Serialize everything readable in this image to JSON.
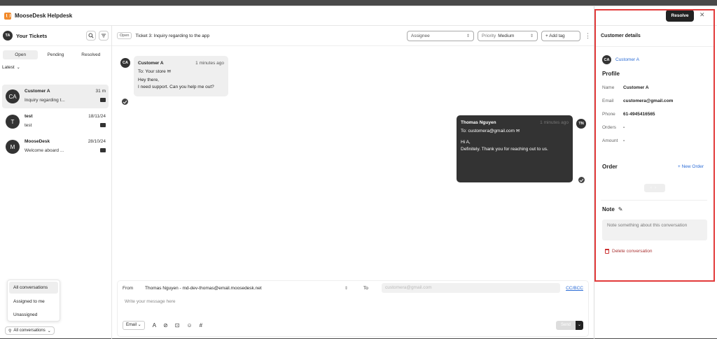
{
  "app": {
    "title": "MooseDesk Helpdesk"
  },
  "sidebar": {
    "avatar": "TA",
    "title": "Your Tickets",
    "tabs": [
      "Open",
      "Pending",
      "Resolved"
    ],
    "sort_label": "Latest",
    "conversations": [
      {
        "avatar": "CA",
        "name": "Customer A",
        "preview": "Inquiry regarding t...",
        "time": "31 m"
      },
      {
        "avatar": "T",
        "name": "test",
        "preview": "test",
        "time": "18/11/24"
      },
      {
        "avatar": "M",
        "name": "MooseDesk",
        "preview": "Welcome aboard ...",
        "time": "28/10/24"
      }
    ],
    "filter_menu": [
      "All conversations",
      "Assigned to me",
      "Unassigned"
    ],
    "filter_button": "All conversations"
  },
  "ticket": {
    "status": "Open",
    "title": "Ticket 3: Inquiry regarding to the app",
    "assignee_placeholder": "Assignee",
    "priority_label": "Priority",
    "priority_value": "Medium",
    "add_tag": "+ Add tag"
  },
  "messages": [
    {
      "avatar": "CA",
      "name": "Customer A",
      "time": "1 minutes ago",
      "to": "To: Your store",
      "lines": [
        "Hey there,",
        "I need support. Can you help me out?"
      ]
    },
    {
      "avatar": "TN",
      "name": "Thomas Nguyen",
      "time": "1 minutes ago",
      "to": "To: customera@gmail.com",
      "lines": [
        "Hi A,",
        "Definitely. Thank you for reaching out to us."
      ]
    }
  ],
  "composer": {
    "from_label": "From",
    "from_value": "Thomas Nguyen - md-dev-thomas@email.moosedesk.net",
    "to_label": "To",
    "to_value": "customera@gmail.com",
    "cc_bcc": "CC/BCC",
    "placeholder": "Write your message here",
    "type": "Email",
    "send": "Send"
  },
  "customer_panel": {
    "resolve": "Resolve",
    "title": "Customer details",
    "avatar": "CA",
    "customer_name": "Customer A",
    "profile_heading": "Profile",
    "fields": [
      {
        "label": "Name",
        "value": "Customer A"
      },
      {
        "label": "Email",
        "value": "customera@gmail.com"
      },
      {
        "label": "Phone",
        "value": "61-4945416565"
      },
      {
        "label": "Orders",
        "value": "-"
      },
      {
        "label": "Amount",
        "value": "-"
      }
    ],
    "order_heading": "Order",
    "new_order": "+ New Order",
    "note_heading": "Note",
    "note_placeholder": "Note something about this conversation",
    "delete": "Delete conversation"
  }
}
